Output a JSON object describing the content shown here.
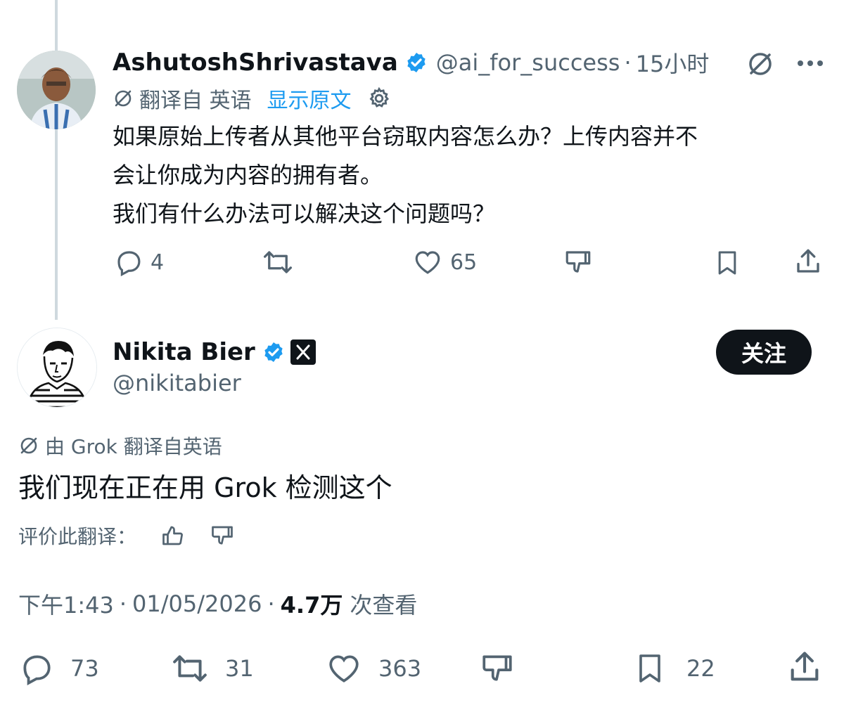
{
  "reply": {
    "author_name": "AshutoshShrivastava",
    "handle": "@ai_for_success",
    "separator": "·",
    "time_ago": "15小时",
    "translated_from": "翻译自 英语",
    "show_original": "显示原文",
    "text_line1": "如果原始上传者从其他平台窃取内容怎么办？上传内容并不",
    "text_line2": "会让你成为内容的拥有者。",
    "text_line3": "我们有什么办法可以解决这个问题吗？",
    "replies": "4",
    "likes": "65"
  },
  "main": {
    "author_name": "Nikita Bier",
    "handle": "@nikitabier",
    "follow_label": "关注",
    "translated_by": "由 Grok 翻译自英语",
    "text": "我们现在正在用 Grok 检测这个",
    "rate_translation": "评价此翻译：",
    "time": "下午1:43",
    "dot1": "·",
    "date": "01/05/2026",
    "dot2": "·",
    "views_count": "4.7万",
    "views_label": "次查看",
    "replies": "73",
    "retweets": "31",
    "likes": "363",
    "bookmarks": "22"
  },
  "colors": {
    "text": "#0f1419",
    "secondary": "#536471",
    "link": "#1d9bf0",
    "verified": "#1d9bf0",
    "follow_bg": "#0f1419"
  },
  "icons": [
    "verified-badge-icon",
    "grok-icon",
    "more-icon",
    "translate-icon",
    "gear-icon",
    "reply-icon",
    "retweet-icon",
    "like-icon",
    "dislike-icon",
    "bookmark-icon",
    "share-icon",
    "x-logo-icon",
    "thumbs-up-icon",
    "thumbs-down-icon"
  ]
}
